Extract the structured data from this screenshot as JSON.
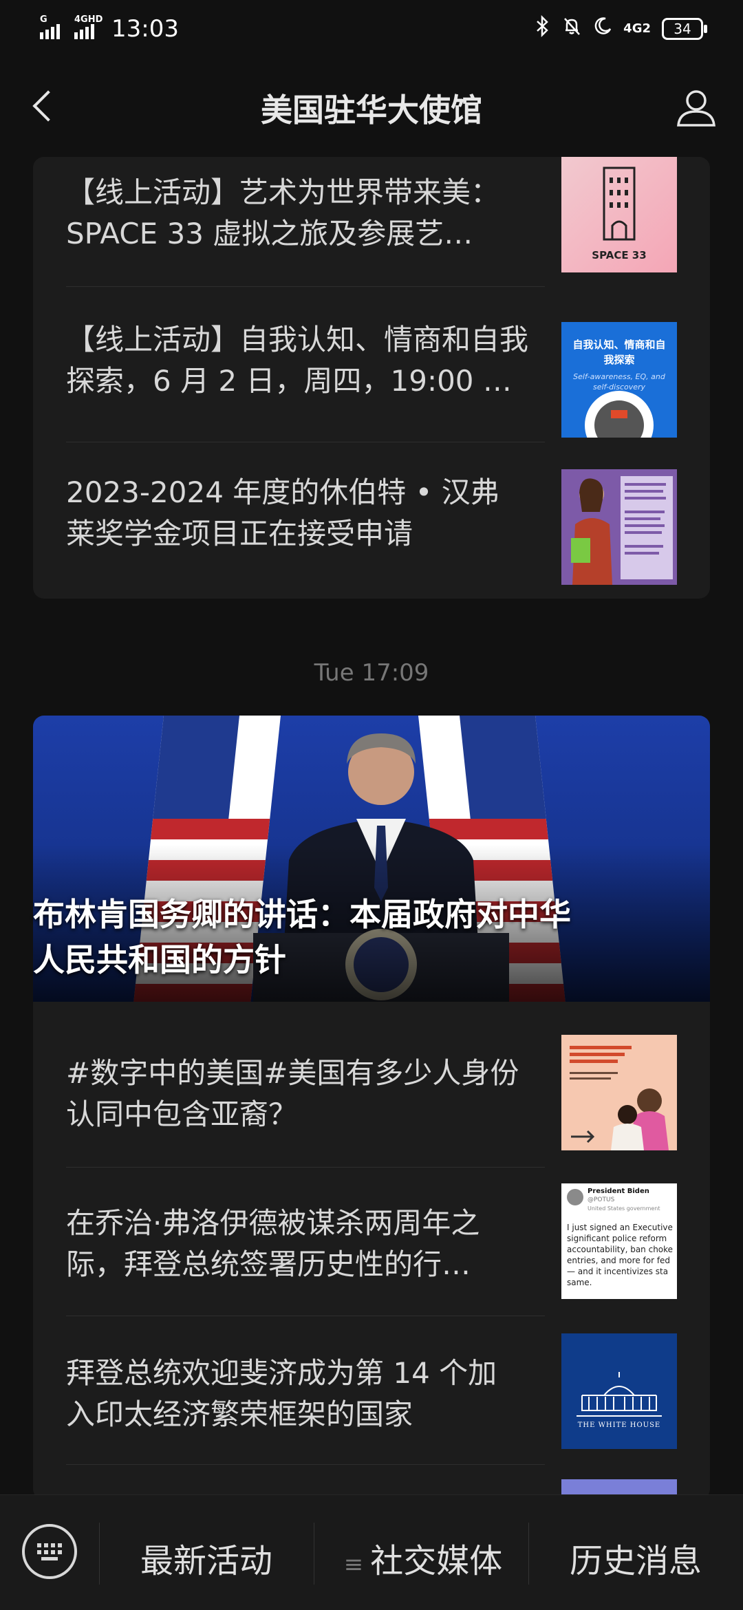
{
  "status_bar": {
    "time": "13:03",
    "sim1_label": "G",
    "sim2_label": "4GHD",
    "net_label": "4G2",
    "battery": "34"
  },
  "header": {
    "title": "美国驻华大使馆"
  },
  "group1": {
    "items": [
      {
        "line1": "【线上活动】艺术为世界带来美：",
        "line2": "SPACE 33 虚拟之旅及参展艺…",
        "thumb_text": "SPACE 33"
      },
      {
        "line1": "【线上活动】自我认知、情商和自我",
        "line2": "探索，6 月 2 日，周四，19:00 …",
        "thumb_title": "自我认知、情商和自我探索",
        "thumb_sub": "Self-awareness, EQ, and self-discovery"
      },
      {
        "line1": "2023-2024 年度的休伯特 • 汉弗",
        "line2": "莱奖学金项目正在接受申请"
      }
    ]
  },
  "timestamp": "Tue 17:09",
  "group2": {
    "hero_title_line1": "布林肯国务卿的讲话：本届政府对中华",
    "hero_title_line2": "人民共和国的方针",
    "items": [
      {
        "line1": "#数字中的美国#美国有多少人身份",
        "line2": "认同中包含亚裔？"
      },
      {
        "line1": "在乔治·弗洛伊德被谋杀两周年之",
        "line2": "际，拜登总统签署历史性的行…",
        "tweet_name": "President Biden",
        "tweet_handle": "@POTUS",
        "tweet_tag": "United States government",
        "tweet_body": "I just signed an Executive significant police reform accountability, ban choke entries, and more for fed — and it incentivizes sta same."
      },
      {
        "line1": "拜登总统欢迎斐济成为第 14 个加",
        "line2": "入印太经济繁荣框架的国家",
        "thumb_caption": "THE WHITE HOUSE"
      }
    ]
  },
  "bottom_nav": {
    "tab1": "最新活动",
    "tab2": "社交媒体",
    "tab3": "历史消息"
  }
}
